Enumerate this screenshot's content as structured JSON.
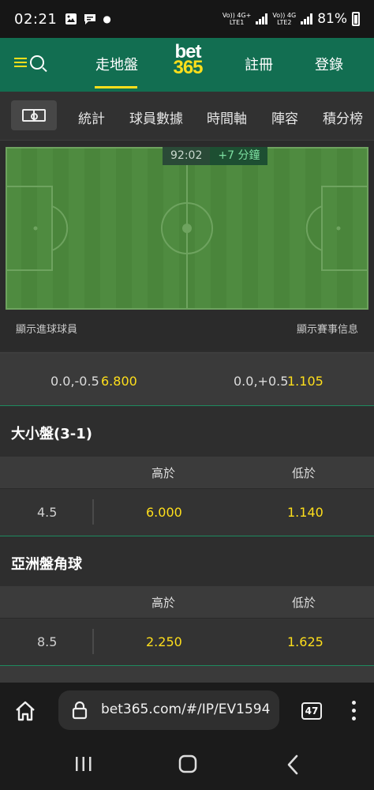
{
  "status_bar": {
    "time": "02:21",
    "sim1": "LTE1",
    "sim2": "LTE2",
    "net1": "4G+",
    "net2": "4G",
    "battery": "81%"
  },
  "header": {
    "nav_inplay": "走地盤",
    "logo_top": "bet",
    "logo_bottom": "365",
    "nav_register": "註冊",
    "nav_login": "登錄"
  },
  "tabs": {
    "items": [
      "統計",
      "球員數據",
      "時間軸",
      "陣容",
      "積分榜"
    ]
  },
  "pitch": {
    "clock": "92:02",
    "extra_time": "+7 分鐘",
    "link_left": "顯示進球球員",
    "link_right": "顯示賽事信息"
  },
  "handicap": {
    "home_line": "0.0,-0.5",
    "home_odds": "6.800",
    "away_line": "0.0,+0.5",
    "away_odds": "1.105"
  },
  "markets": [
    {
      "title": "大小盤(3-1)",
      "col_over": "高於",
      "col_under": "低於",
      "line": "4.5",
      "over": "6.000",
      "under": "1.140"
    },
    {
      "title": "亞洲盤角球",
      "col_over": "高於",
      "col_under": "低於",
      "line": "8.5",
      "over": "2.250",
      "under": "1.625"
    }
  ],
  "browser": {
    "url": "bet365.com/#/IP/EV1594",
    "tab_count": "47"
  },
  "colors": {
    "brand_green": "#126e51",
    "brand_yellow": "#ffdf1b",
    "pitch_green": "#4e8a3e"
  }
}
